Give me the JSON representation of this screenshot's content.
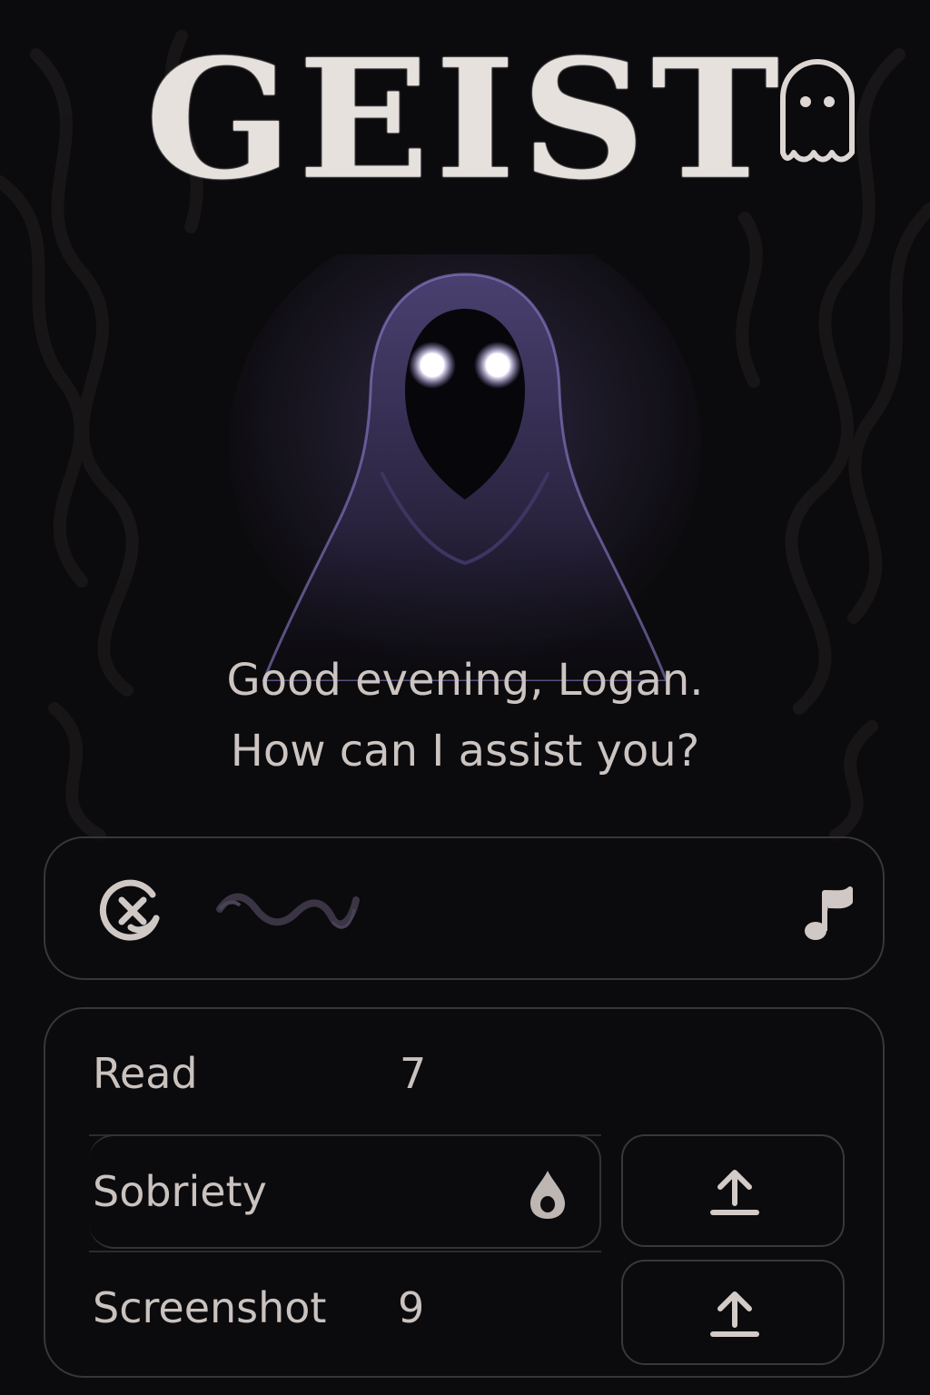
{
  "app": {
    "title": "GEIST"
  },
  "greeting": {
    "line1": "Good evening, Logan.",
    "line2": "How can I assist you?"
  },
  "player": {
    "cancel_icon": "cancel-icon",
    "waveform_icon": "serpent-waveform-icon",
    "music_icon": "music-note-icon"
  },
  "stats": {
    "rows": [
      {
        "label": "Read",
        "value": "7"
      },
      {
        "label": "Sobriety",
        "icon": "drop-icon"
      },
      {
        "label": "Screenshot",
        "value": "9"
      }
    ],
    "upload_icon": "upload-icon"
  },
  "colors": {
    "background": "#0b0a0c",
    "text": "#cbc4c1",
    "accent_glow": "#8b7bd0",
    "border": "#3a3638"
  }
}
